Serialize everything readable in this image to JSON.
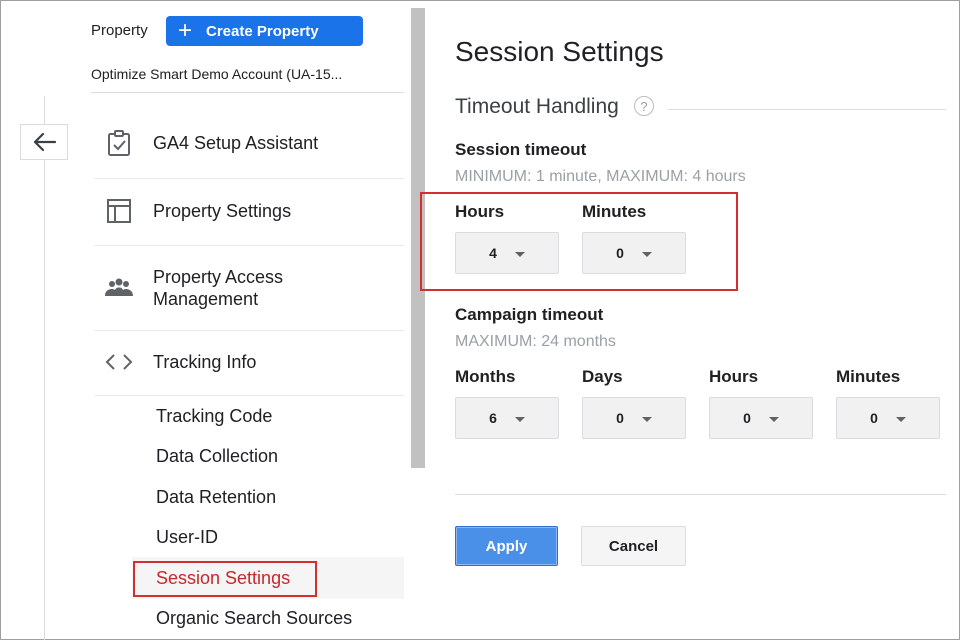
{
  "property": {
    "label": "Property",
    "create_button": "Create Property",
    "account_name": "Optimize Smart Demo Account (UA-15..."
  },
  "nav": {
    "items": [
      {
        "label": "GA4 Setup Assistant",
        "icon": "clipboard-check-icon"
      },
      {
        "label": "Property Settings",
        "icon": "layout-icon"
      },
      {
        "label": "Property Access Management",
        "icon": "people-icon"
      },
      {
        "label": "Tracking Info",
        "icon": "code-icon"
      }
    ],
    "sub_items": [
      "Tracking Code",
      "Data Collection",
      "Data Retention",
      "User-ID",
      "Session Settings",
      "Organic Search Sources"
    ],
    "active_sub_item": "Session Settings"
  },
  "main": {
    "title": "Session Settings",
    "section_title": "Timeout Handling",
    "session_timeout": {
      "label": "Session timeout",
      "hint": "MINIMUM: 1 minute, MAXIMUM: 4 hours",
      "hours_label": "Hours",
      "hours_value": "4",
      "minutes_label": "Minutes",
      "minutes_value": "0"
    },
    "campaign_timeout": {
      "label": "Campaign timeout",
      "hint": "MAXIMUM: 24 months",
      "months_label": "Months",
      "months_value": "6",
      "days_label": "Days",
      "days_value": "0",
      "hours_label": "Hours",
      "hours_value": "0",
      "minutes_label": "Minutes",
      "minutes_value": "0"
    },
    "apply_label": "Apply",
    "cancel_label": "Cancel"
  },
  "colors": {
    "accent": "#1a73e8",
    "highlight_outline": "#d32f2f"
  }
}
